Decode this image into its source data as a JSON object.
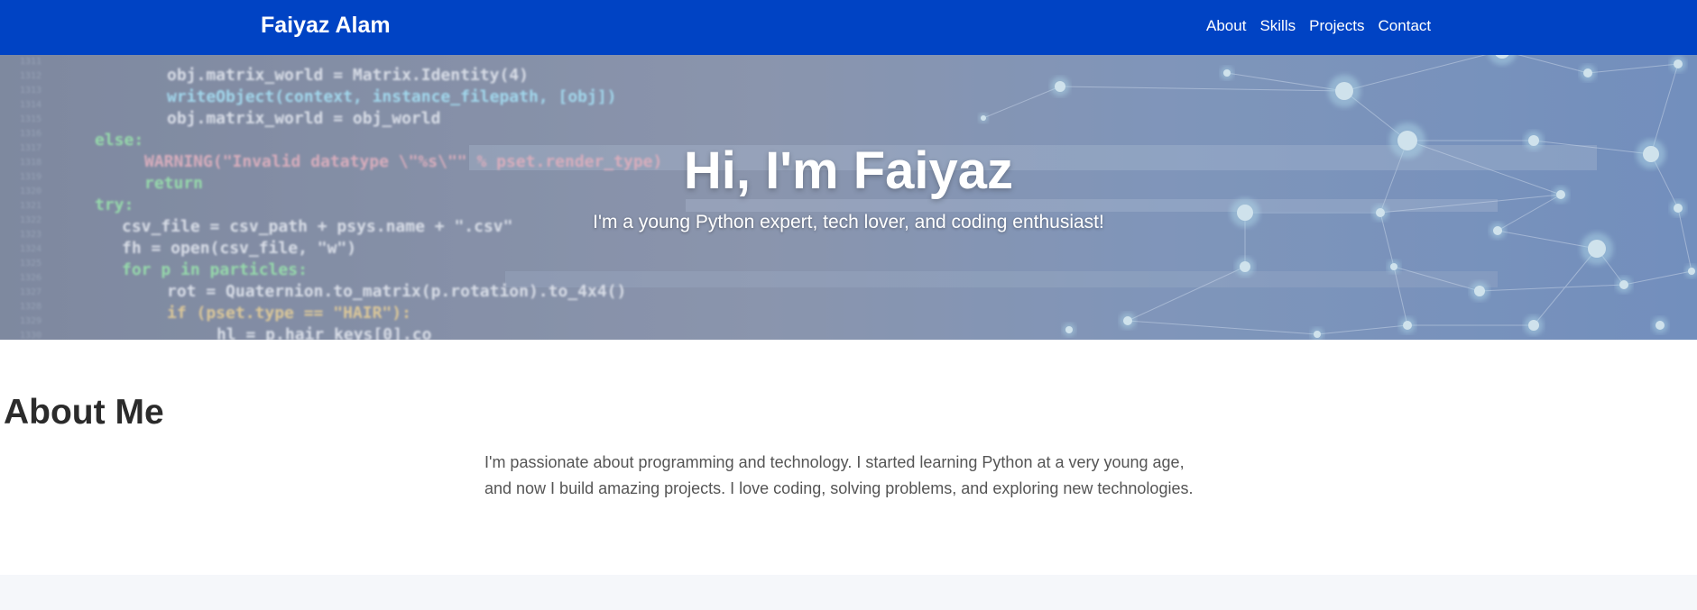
{
  "nav": {
    "brand": "Faiyaz Alam",
    "links": [
      "About",
      "Skills",
      "Projects",
      "Contact"
    ]
  },
  "hero": {
    "title": "Hi, I'm Faiyaz",
    "subtitle": "I'm a young Python expert, tech lover, and coding enthusiast!",
    "code_lines": [
      "obj.matrix_world = Matrix.Identity(4)",
      "writeObject(context, instance_filepath, [obj])",
      "obj.matrix_world = obj_world",
      "else:",
      "WARNING(\"Invalid datatype \\\"%s\\\"\" % pset.render_type)",
      "return",
      "try:",
      "csv_file = csv_path + psys.name + \".csv\"",
      "fh = open(csv_file, \"w\")",
      "for p in particles:",
      "rot = Quaternion.to_matrix(p.rotation).to_4x4()",
      "if (pset.type == \"HAIR\"):",
      "hl = p.hair_keys[0].co"
    ],
    "line_numbers": [
      "1311",
      "1312",
      "1313",
      "1314",
      "1315",
      "1316",
      "1317",
      "1318",
      "1319",
      "1320",
      "1321",
      "1322",
      "1323",
      "1324",
      "1325",
      "1326",
      "1327",
      "1328",
      "1329",
      "1330"
    ]
  },
  "about": {
    "heading": "About Me",
    "text": "I'm passionate about programming and technology. I started learning Python at a very young age, and now I build amazing projects. I love coding, solving problems, and exploring new technologies."
  },
  "colors": {
    "nav_bg": "#0043c4",
    "heading": "#2b2b2b",
    "body_text": "#555555"
  }
}
